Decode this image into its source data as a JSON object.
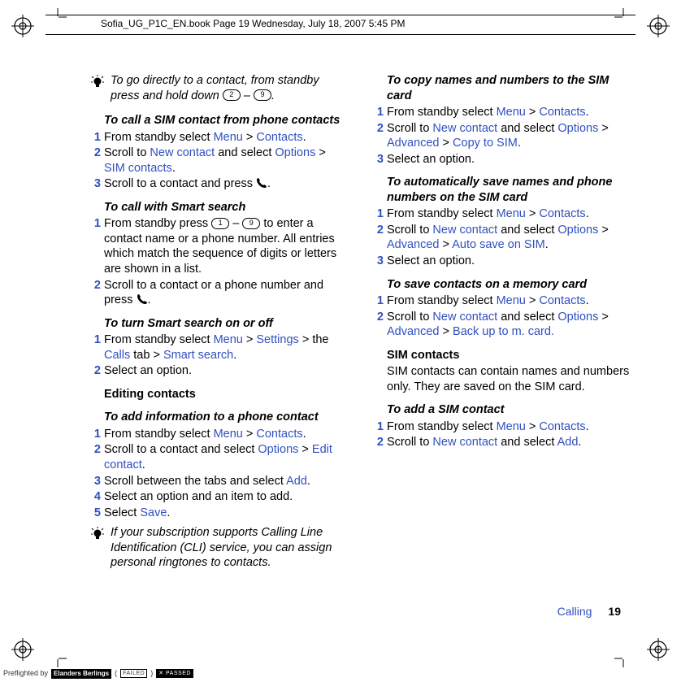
{
  "header": {
    "runHead": "Sofia_UG_P1C_EN.book  Page 19  Wednesday, July 18, 2007  5:45 PM"
  },
  "footer": {
    "sectionLabel": "Calling",
    "pageNumber": "19"
  },
  "preflight": {
    "label": "Preflighted by",
    "brand": "Elanders Berlings",
    "failed": "FAILED",
    "passed": "PASSED"
  },
  "tips": {
    "goto_contact": "To go directly to a contact, from standby press and hold down ",
    "goto_contact_dash": " – ",
    "goto_contact_end": ".",
    "cli": "If your subscription supports Calling Line Identification (CLI) service, you can assign personal ringtones to contacts."
  },
  "keys": {
    "one": "1",
    "two": "2",
    "nine": "9"
  },
  "sections": {
    "sim_from_phone": {
      "title": "To call a SIM contact from phone contacts",
      "s1a": "From standby select ",
      "s1_menu": "Menu",
      "s1_gt": " > ",
      "s1_contacts": "Contacts",
      "s1_end": ".",
      "s2a": "Scroll to ",
      "s2_new": "New contact",
      "s2b": " and select ",
      "s2_opt": "Options",
      "s2_gt": " > ",
      "s2_sim": "SIM contacts",
      "s2_end": ".",
      "s3": "Scroll to a contact and press ",
      "s3_end": "."
    },
    "smart_call": {
      "title": "To call with Smart search",
      "s1a": "From standby press ",
      "s1b": " – ",
      "s1c": " to enter a contact name or a phone number. All entries which match the sequence of digits or letters are shown in a list.",
      "s2": "Scroll to a contact or a phone number and press ",
      "s2_end": "."
    },
    "smart_toggle": {
      "title": "To turn Smart search on or off",
      "s1a": "From standby select ",
      "s1_menu": "Menu",
      "s1_gt": " > ",
      "s1_settings": "Settings",
      "s1b": " > the ",
      "s1_calls": "Calls",
      "s1c": " tab > ",
      "s1_smart": "Smart search",
      "s1_end": ".",
      "s2": "Select an option."
    },
    "editing_h": "Editing contacts",
    "add_info": {
      "title": "To add information to a phone contact",
      "s1a": "From standby select ",
      "s1_menu": "Menu",
      "s1_gt": " > ",
      "s1_contacts": "Contacts",
      "s1_end": ".",
      "s2a": "Scroll to a contact and select ",
      "s2_opt": "Options",
      "s2_gt": " > ",
      "s2_edit": "Edit contact",
      "s2_end": ".",
      "s3a": "Scroll between the tabs and select ",
      "s3_add": "Add",
      "s3_end": ".",
      "s4": "Select an option and an item to add.",
      "s5a": "Select ",
      "s5_save": "Save",
      "s5_end": "."
    },
    "copy_sim": {
      "title": "To copy names and numbers to the SIM card",
      "s1a": "From standby select ",
      "s1_menu": "Menu",
      "s1_gt": " > ",
      "s1_contacts": "Contacts",
      "s1_end": ".",
      "s2a": "Scroll to ",
      "s2_new": "New contact",
      "s2b": " and select ",
      "s2_opt": "Options",
      "s2_gt1": " > ",
      "s2_adv": "Advanced",
      "s2_gt2": " > ",
      "s2_copy": "Copy to SIM",
      "s2_end": ".",
      "s3": "Select an option."
    },
    "auto_sim": {
      "title": "To automatically save names and phone numbers on the SIM card",
      "s1a": "From standby select ",
      "s1_menu": "Menu",
      "s1_gt": " > ",
      "s1_contacts": "Contacts",
      "s1_end": ".",
      "s2a": "Scroll to ",
      "s2_new": "New contact",
      "s2b": " and select ",
      "s2_opt": "Options",
      "s2_gt1": " > ",
      "s2_adv": "Advanced",
      "s2_gt2": " > ",
      "s2_auto": "Auto save on SIM",
      "s2_end": ".",
      "s3": "Select an option."
    },
    "mem_card": {
      "title": "To save contacts on a memory card",
      "s1a": "From standby select ",
      "s1_menu": "Menu",
      "s1_gt": " > ",
      "s1_contacts": "Contacts",
      "s1_end": ".",
      "s2a": "Scroll to ",
      "s2_new": "New contact",
      "s2b": " and select ",
      "s2_opt": "Options",
      "s2_gt1": " > ",
      "s2_adv": "Advanced",
      "s2_gt2": " > ",
      "s2_back": "Back up to m. card.",
      "s2_end": ""
    },
    "sim_contacts_h": "SIM contacts",
    "sim_contacts_p": "SIM contacts can contain names and numbers only. They are saved on the SIM card.",
    "add_sim": {
      "title": "To add a SIM contact",
      "s1a": "From standby select ",
      "s1_menu": "Menu",
      "s1_gt": " > ",
      "s1_contacts": "Contacts",
      "s1_end": ".",
      "s2a": "Scroll to ",
      "s2_new": "New contact",
      "s2b": " and select ",
      "s2_add": "Add",
      "s2_end": "."
    }
  }
}
